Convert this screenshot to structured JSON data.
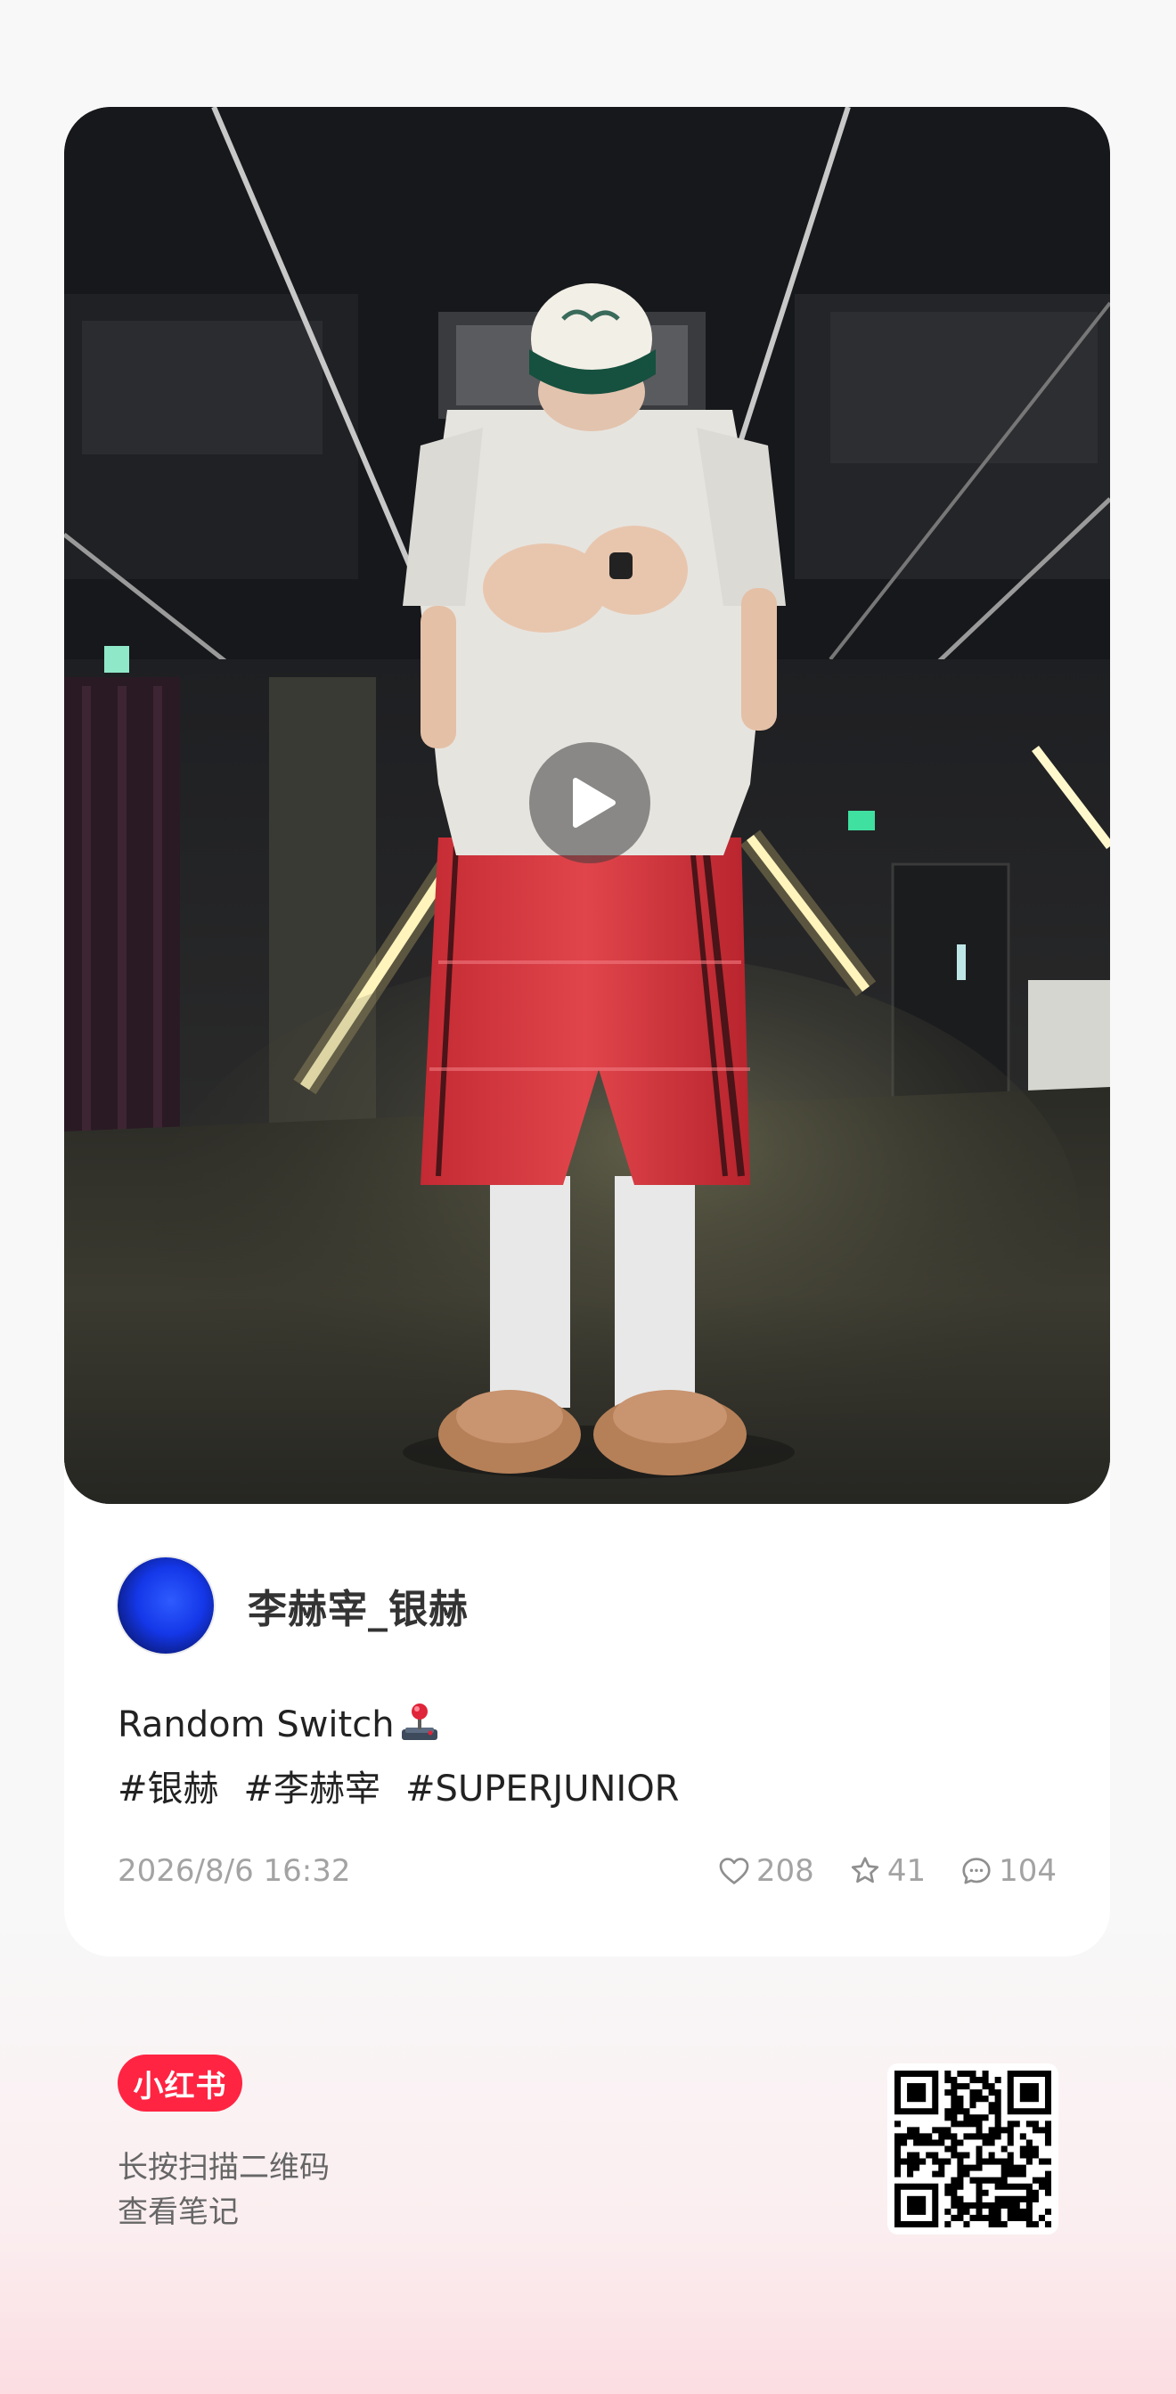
{
  "author": {
    "name": "李赫宰_银赫"
  },
  "post": {
    "title": "Random Switch",
    "title_emoji": "joystick-icon",
    "tags": [
      "#银赫",
      "#李赫宰",
      "#SUPERJUNIOR"
    ],
    "date": "2026/8/6 16:32",
    "likes": "208",
    "favorites": "41",
    "comments": "104"
  },
  "footer": {
    "brand": "小红书",
    "hint_line1": "长按扫描二维码",
    "hint_line2": "查看笔记"
  },
  "colors": {
    "brand": "#ff2442",
    "meta_text": "#a3a3a3",
    "body_text": "#222222"
  }
}
